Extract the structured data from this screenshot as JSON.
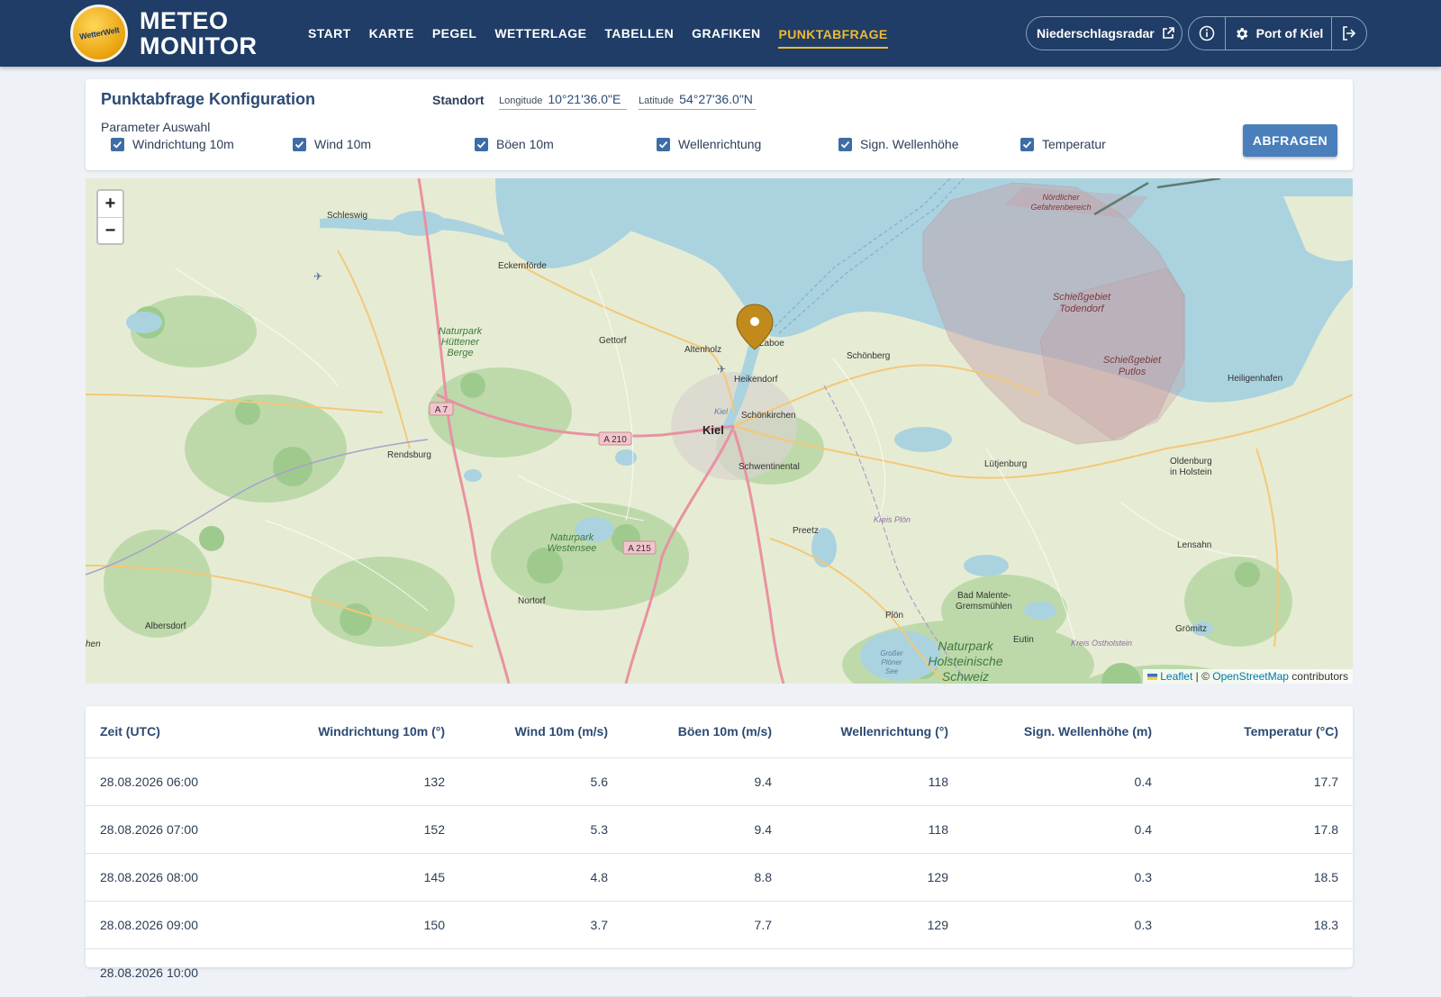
{
  "header": {
    "logo_text": "WetterWelt",
    "brand_line1": "METEO",
    "brand_line2": "MONITOR",
    "nav": [
      "START",
      "KARTE",
      "PEGEL",
      "WETTERLAGE",
      "TABELLEN",
      "GRAFIKEN",
      "PUNKTABFRAGE"
    ],
    "active_nav": "PUNKTABFRAGE",
    "radar_label": "Niederschlagsradar",
    "port_label": "Port of Kiel"
  },
  "config": {
    "title": "Punktabfrage Konfiguration",
    "standort_label": "Standort",
    "longitude_label": "Longitude",
    "longitude_value": "10°21'36.0\"E",
    "latitude_label": "Latitude",
    "latitude_value": "54°27'36.0\"N",
    "param_label": "Parameter Auswahl",
    "params": [
      {
        "label": "Windrichtung 10m",
        "checked": true
      },
      {
        "label": "Wind 10m",
        "checked": true
      },
      {
        "label": "Böen 10m",
        "checked": true
      },
      {
        "label": "Wellenrichtung",
        "checked": true
      },
      {
        "label": "Sign. Wellenhöhe",
        "checked": true
      },
      {
        "label": "Temperatur",
        "checked": true
      }
    ],
    "query_button": "ABFRAGEN"
  },
  "map": {
    "zoom_in": "+",
    "zoom_out": "−",
    "attribution_leaflet": "Leaflet",
    "attribution_sep": " | © ",
    "attribution_osm": "OpenStreetMap",
    "attribution_suffix": " contributors",
    "labels": {
      "schleswig": "Schleswig",
      "eckernfoerde": "Eckernförde",
      "huetten1": "Naturpark",
      "huetten2": "Hüttener",
      "huetten3": "Berge",
      "gettorf": "Gettorf",
      "altenholz": "Altenholz",
      "laboe": "Laboe",
      "heikendorf": "Heikendorf",
      "schoenberg": "Schönberg",
      "kiel": "Kiel",
      "kiel_small": "Kiel",
      "schoenkirchen": "Schönkirchen",
      "schwentinental": "Schwentinental",
      "rendsburg": "Rendsburg",
      "a7": "A 7",
      "a210": "A 210",
      "a215": "A 215",
      "westensee1": "Naturpark",
      "westensee2": "Westensee",
      "preetz": "Preetz",
      "kreisploen": "Kreis Plön",
      "luetjenburg": "Lütjenburg",
      "nortorf": "Nortorf",
      "albersdorf": "Albersdorf",
      "hen": "hen",
      "badmalente1": "Bad Malente-",
      "badmalente2": "Gremsmühlen",
      "ploen": "Plön",
      "holst1": "Naturpark",
      "holst2": "Holsteinische",
      "holst3": "Schweiz",
      "grosser1": "Großer",
      "grosser2": "Plöner",
      "grosser3": "See",
      "eutin": "Eutin",
      "ostholstein": "Kreis Ostholstein",
      "groemitz": "Grömitz",
      "lensahn": "Lensahn",
      "oldenburg1": "Oldenburg",
      "oldenburg2": "in Holstein",
      "heiligenhafen": "Heiligenhafen",
      "todendorf1": "Schießgebiet",
      "todendorf2": "Todendorf",
      "putlos1": "Schießgebiet",
      "putlos2": "Putlos",
      "nord1": "Nördlicher",
      "nord2": "Gefahrenbereich"
    },
    "colors": {
      "water": "#aad3df",
      "land": "#e6ecd3",
      "forest": "#add19e",
      "marker": "#c08a1c",
      "restricted": "#c6a0a8"
    }
  },
  "table": {
    "columns": [
      "Zeit (UTC)",
      "Windrichtung 10m (°)",
      "Wind 10m (m/s)",
      "Böen 10m (m/s)",
      "Wellenrichtung (°)",
      "Sign. Wellenhöhe (m)",
      "Temperatur (°C)"
    ],
    "rows": [
      [
        "28.08.2026 06:00",
        "132",
        "5.6",
        "9.4",
        "118",
        "0.4",
        "17.7"
      ],
      [
        "28.08.2026 07:00",
        "152",
        "5.3",
        "9.4",
        "118",
        "0.4",
        "17.8"
      ],
      [
        "28.08.2026 08:00",
        "145",
        "4.8",
        "8.8",
        "129",
        "0.3",
        "18.5"
      ],
      [
        "28.08.2026 09:00",
        "150",
        "3.7",
        "7.7",
        "129",
        "0.3",
        "18.3"
      ],
      [
        "28.08.2026 10:00",
        "",
        "",
        "",
        "",
        "",
        ""
      ]
    ]
  }
}
